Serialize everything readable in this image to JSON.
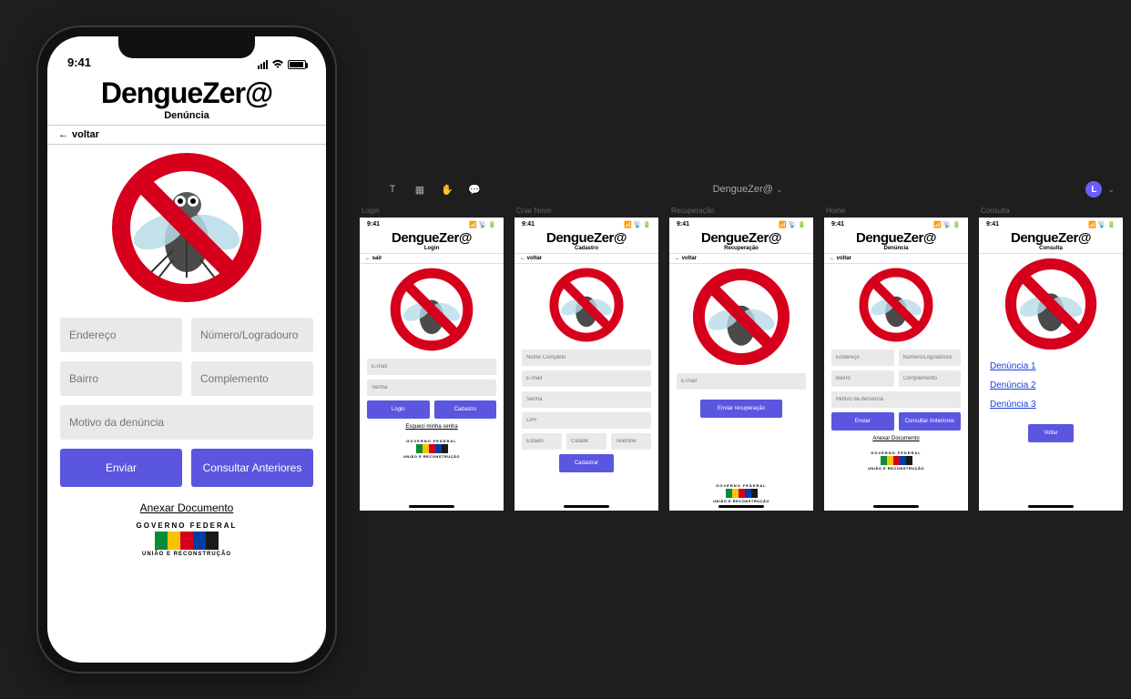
{
  "colors": {
    "primary": "#5a56e0",
    "field": "#e9e9e9"
  },
  "status_time": "9:41",
  "app_title": "DengueZer@",
  "gov": {
    "top": "GOVERNO FEDERAL",
    "bottom": "UNIÃO E RECONSTRUÇÃO"
  },
  "toolbar": {
    "project_name": "DengueZer@",
    "user_initial": "L"
  },
  "main_screen": {
    "subtitle": "Denúncia",
    "back_label": "voltar",
    "fields": {
      "endereco": "Endereço",
      "numero": "Número/Logradouro",
      "bairro": "Bairro",
      "complemento": "Complemento",
      "motivo": "Motivo da denúncia"
    },
    "buttons": {
      "enviar": "Enviar",
      "consultar": "Consultar Anteriores"
    },
    "attach": "Anexar Documento"
  },
  "artboards": {
    "login": {
      "label": "Login",
      "subtitle": "Login",
      "back": "sair",
      "email": "E-mail",
      "senha": "Senha",
      "btn_login": "Login",
      "btn_cadastro": "Cadastro",
      "forgot": "Esqueci minha senha"
    },
    "cadastro": {
      "label": "Criar Novo",
      "subtitle": "Cadastro",
      "back": "voltar",
      "nome": "Nome Completo",
      "email": "E-mail",
      "senha": "Senha",
      "cpf": "CPF",
      "estado": "Estado",
      "cidade": "Cidade",
      "telefone": "Telefone",
      "btn": "Cadastrar"
    },
    "recuperacao": {
      "label": "Recuperação",
      "subtitle": "Recuperação",
      "back": "voltar",
      "email": "E-mail",
      "btn": "Enviar recuperação"
    },
    "denuncia": {
      "label": "Home",
      "subtitle": "Denúncia",
      "back": "voltar",
      "endereco": "Endereço",
      "numero": "Número/Logradouro",
      "bairro": "Bairro",
      "complemento": "Complemento",
      "motivo": "Motivo da denúncia",
      "btn_enviar": "Enviar",
      "btn_consultar": "Consultar Anteriores",
      "attach": "Anexar Documento"
    },
    "consulta": {
      "label": "Consulta",
      "subtitle": "Consulta",
      "items": [
        "Denúncia 1",
        "Denúncia 2",
        "Denúncia 3"
      ],
      "btn": "Voltar"
    }
  }
}
